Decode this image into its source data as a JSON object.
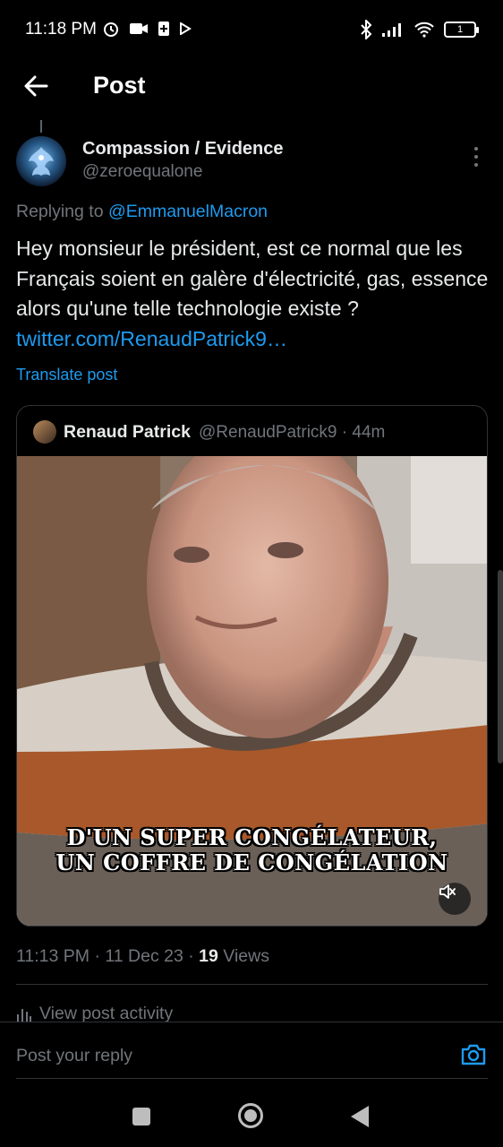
{
  "status_bar": {
    "time": "11:18 PM",
    "battery": "1"
  },
  "header": {
    "title": "Post"
  },
  "post": {
    "display_name": "Compassion / Evidence",
    "handle": "@zeroequalone",
    "replying_prefix": "Replying to",
    "replying_to": "@EmmanuelMacron",
    "text": "Hey monsieur le président, est ce normal que les Français soient en galère d'électricité, gas, essence alors qu'une telle technologie existe ?",
    "link": "twitter.com/RenaudPatrick9…",
    "translate_label": "Translate post",
    "time": "11:13 PM",
    "date": "11 Dec 23",
    "views_count": "19",
    "views_label": "Views",
    "activity_label": "View post activity"
  },
  "quote": {
    "display_name": "Renaud Patrick",
    "handle": "@RenaudPatrick9",
    "age": "44m",
    "caption_line1": "D'UN SUPER CONGÉLATEUR,",
    "caption_line2": "UN COFFRE DE CONGÉLATION"
  },
  "reply": {
    "placeholder": "Post your reply"
  },
  "colors": {
    "accent": "#1d9bf0",
    "muted": "#71767b",
    "text": "#e7e9ea",
    "border": "#2f3336"
  }
}
